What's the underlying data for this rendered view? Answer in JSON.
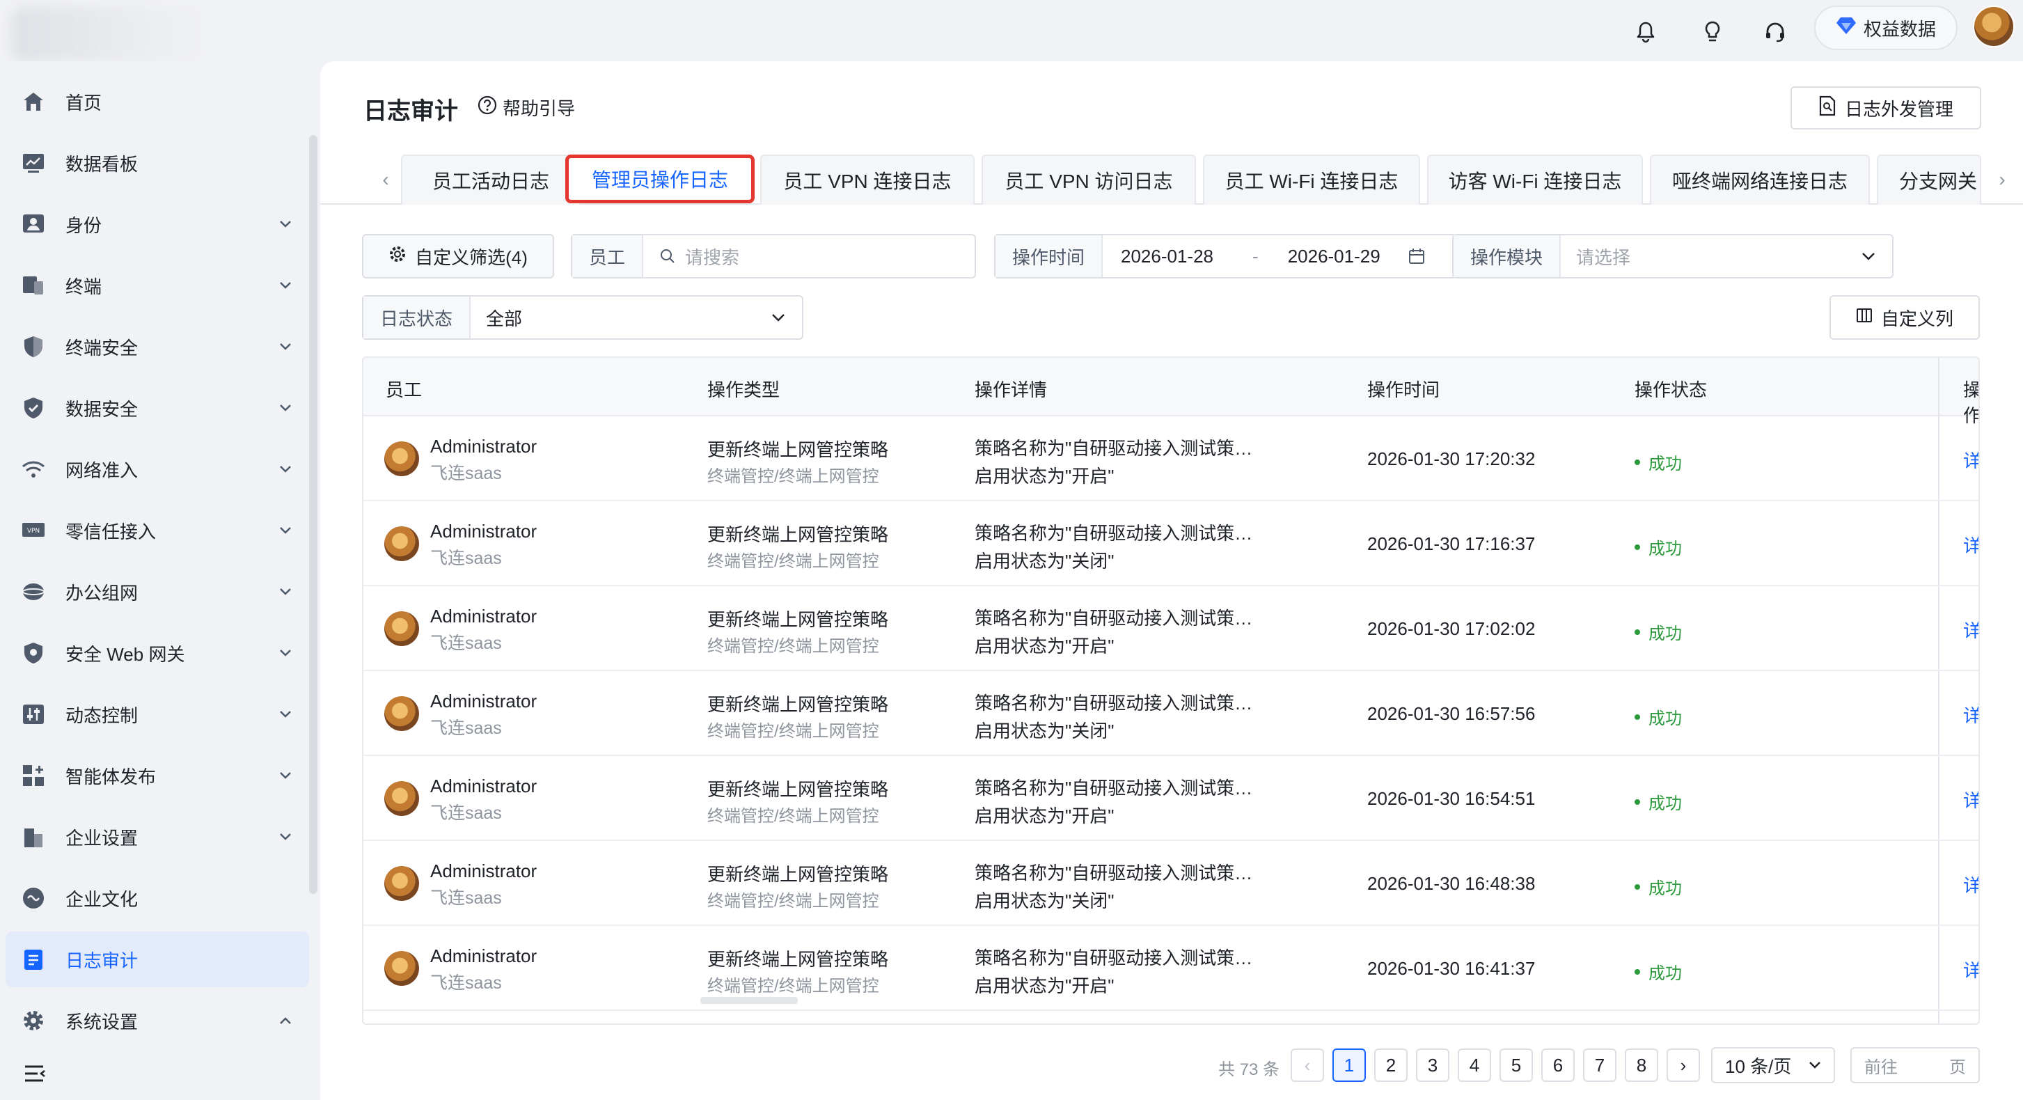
{
  "header": {
    "rights_label": "权益数据",
    "icons": [
      "bell-icon",
      "lightbulb-icon",
      "headset-icon"
    ]
  },
  "sidebar": {
    "items": [
      {
        "label": "首页",
        "icon": "home-icon",
        "expandable": false
      },
      {
        "label": "数据看板",
        "icon": "dashboard-icon",
        "expandable": false
      },
      {
        "label": "身份",
        "icon": "identity-icon",
        "expandable": true
      },
      {
        "label": "终端",
        "icon": "terminal-icon",
        "expandable": true
      },
      {
        "label": "终端安全",
        "icon": "shield-icon",
        "expandable": true
      },
      {
        "label": "数据安全",
        "icon": "shield-check-icon",
        "expandable": true
      },
      {
        "label": "网络准入",
        "icon": "wifi-icon",
        "expandable": true
      },
      {
        "label": "零信任接入",
        "icon": "vpn-icon",
        "expandable": true
      },
      {
        "label": "办公组网",
        "icon": "network-icon",
        "expandable": true
      },
      {
        "label": "安全 Web 网关",
        "icon": "web-gateway-icon",
        "expandable": true
      },
      {
        "label": "动态控制",
        "icon": "sliders-icon",
        "expandable": true
      },
      {
        "label": "智能体发布",
        "icon": "apps-icon",
        "expandable": true
      },
      {
        "label": "企业设置",
        "icon": "building-icon",
        "expandable": true
      },
      {
        "label": "企业文化",
        "icon": "culture-icon",
        "expandable": false
      },
      {
        "label": "日志审计",
        "icon": "log-icon",
        "expandable": false,
        "active": true
      },
      {
        "label": "系统设置",
        "icon": "gear-icon",
        "expandable": true,
        "expanded": true
      }
    ]
  },
  "page": {
    "title": "日志审计",
    "help": "帮助引导",
    "external_button": "日志外发管理"
  },
  "tabs": [
    {
      "label": "员工活动日志"
    },
    {
      "label": "管理员操作日志",
      "active": true
    },
    {
      "label": "员工 VPN 连接日志"
    },
    {
      "label": "员工 VPN 访问日志"
    },
    {
      "label": "员工 Wi-Fi 连接日志"
    },
    {
      "label": "访客 Wi-Fi 连接日志"
    },
    {
      "label": "哑终端网络连接日志"
    },
    {
      "label": "分支网关"
    }
  ],
  "filters": {
    "custom_filter": "自定义筛选(4)",
    "employee_label": "员工",
    "employee_placeholder": "请搜索",
    "time_label": "操作时间",
    "time_start": "2026-01-28",
    "time_sep": "-",
    "time_end": "2026-01-29",
    "module_label": "操作模块",
    "module_placeholder": "请选择",
    "status_label": "日志状态",
    "status_value": "全部",
    "custom_columns": "自定义列"
  },
  "table": {
    "columns": [
      "员工",
      "操作类型",
      "操作详情",
      "操作时间",
      "操作状态",
      "操作"
    ],
    "rows": [
      {
        "name": "Administrator",
        "org": "飞连saas",
        "type": "更新终端上网管控策略",
        "path": "终端管控/终端上网管控",
        "detail1": "策略名称为\"自研驱动接入测试策…",
        "detail2": "启用状态为\"开启\"",
        "time": "2026-01-30 17:20:32",
        "status": "成功",
        "action": "详情"
      },
      {
        "name": "Administrator",
        "org": "飞连saas",
        "type": "更新终端上网管控策略",
        "path": "终端管控/终端上网管控",
        "detail1": "策略名称为\"自研驱动接入测试策…",
        "detail2": "启用状态为\"关闭\"",
        "time": "2026-01-30 17:16:37",
        "status": "成功",
        "action": "详情"
      },
      {
        "name": "Administrator",
        "org": "飞连saas",
        "type": "更新终端上网管控策略",
        "path": "终端管控/终端上网管控",
        "detail1": "策略名称为\"自研驱动接入测试策…",
        "detail2": "启用状态为\"开启\"",
        "time": "2026-01-30 17:02:02",
        "status": "成功",
        "action": "详情"
      },
      {
        "name": "Administrator",
        "org": "飞连saas",
        "type": "更新终端上网管控策略",
        "path": "终端管控/终端上网管控",
        "detail1": "策略名称为\"自研驱动接入测试策…",
        "detail2": "启用状态为\"关闭\"",
        "time": "2026-01-30 16:57:56",
        "status": "成功",
        "action": "详情"
      },
      {
        "name": "Administrator",
        "org": "飞连saas",
        "type": "更新终端上网管控策略",
        "path": "终端管控/终端上网管控",
        "detail1": "策略名称为\"自研驱动接入测试策…",
        "detail2": "启用状态为\"开启\"",
        "time": "2026-01-30 16:54:51",
        "status": "成功",
        "action": "详情"
      },
      {
        "name": "Administrator",
        "org": "飞连saas",
        "type": "更新终端上网管控策略",
        "path": "终端管控/终端上网管控",
        "detail1": "策略名称为\"自研驱动接入测试策…",
        "detail2": "启用状态为\"关闭\"",
        "time": "2026-01-30 16:48:38",
        "status": "成功",
        "action": "详情"
      },
      {
        "name": "Administrator",
        "org": "飞连saas",
        "type": "更新终端上网管控策略",
        "path": "终端管控/终端上网管控",
        "detail1": "策略名称为\"自研驱动接入测试策…",
        "detail2": "启用状态为\"开启\"",
        "time": "2026-01-30 16:41:37",
        "status": "成功",
        "action": "详情"
      }
    ]
  },
  "pagination": {
    "total": "共 73 条",
    "pages": [
      "1",
      "2",
      "3",
      "4",
      "5",
      "6",
      "7",
      "8"
    ],
    "current": "1",
    "page_size": "10 条/页",
    "jump_prefix": "前往",
    "jump_suffix": "页"
  },
  "colors": {
    "accent": "#1664ff",
    "success": "#2c9a3c",
    "highlight_border": "#e5372f"
  }
}
